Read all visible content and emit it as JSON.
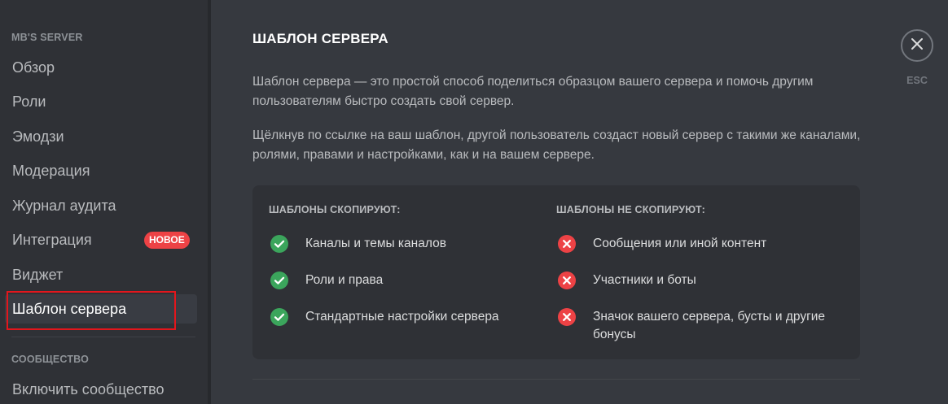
{
  "sidebar": {
    "server_name": "MB'S SERVER",
    "items": [
      {
        "label": "Обзор"
      },
      {
        "label": "Роли"
      },
      {
        "label": "Эмодзи"
      },
      {
        "label": "Модерация"
      },
      {
        "label": "Журнал аудита"
      },
      {
        "label": "Интеграция",
        "badge": "НОВОЕ"
      },
      {
        "label": "Виджет"
      },
      {
        "label": "Шаблон сервера",
        "active": true
      }
    ],
    "community_header": "СООБЩЕСТВО",
    "community_items": [
      {
        "label": "Включить сообщество"
      }
    ]
  },
  "main": {
    "title": "ШАБЛОН СЕРВЕРА",
    "paragraphs": [
      "Шаблон сервера — это простой способ поделиться образцом вашего сервера и помочь другим пользователям быстро создать свой сервер.",
      "Щёлкнув по ссылке на ваш шаблон, другой пользователь создаст новый сервер с такими же каналами, ролями, правами и настройками, как и на вашем сервере."
    ],
    "copied": {
      "title": "ШАБЛОНЫ СКОПИРУЮТ:",
      "items": [
        "Каналы и темы каналов",
        "Роли и права",
        "Стандартные настройки сервера"
      ],
      "icon": "check-circle-icon"
    },
    "not_copied": {
      "title": "ШАБЛОНЫ НЕ СКОПИРУЮТ:",
      "items": [
        "Сообщения или иной контент",
        "Участники и боты",
        "Значок вашего сервера, бусты и другие бонусы"
      ],
      "icon": "x-circle-icon"
    }
  },
  "close": {
    "label": "ESC",
    "icon": "close-icon"
  },
  "colors": {
    "background": "#36393f",
    "sidebar": "#2f3136",
    "success": "#3ba55c",
    "danger": "#ed4245",
    "highlight_border": "#e3161c"
  }
}
